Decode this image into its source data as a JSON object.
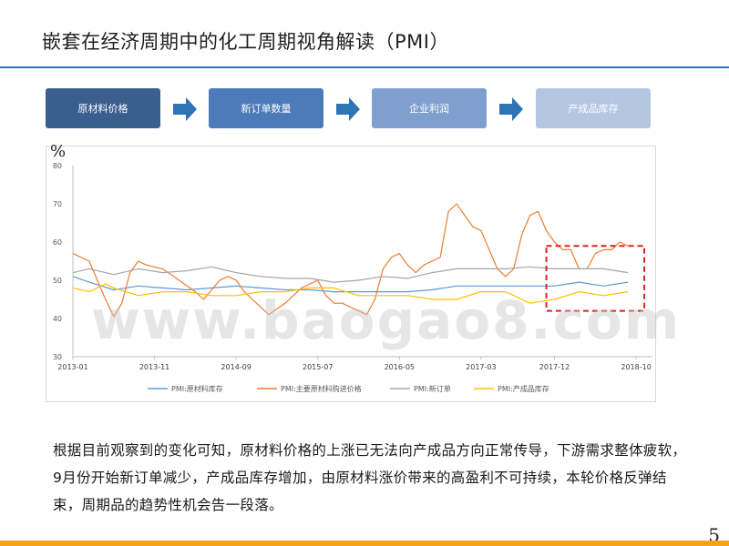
{
  "slide": {
    "title": "嵌套在经济周期中的化工周期视角解读（PMI）",
    "page_number": "5",
    "watermark": "www.baogao8.com",
    "body_text": "根据目前观察到的变化可知，原材料价格的上涨已无法向产成品方向正常传导，下游需求整体疲软，9月份开始新订单减少，产成品库存增加，由原材料涨价带来的高盈利不可持续，本轮价格反弹结束，周期品的趋势性机会告一段落。"
  },
  "flow": [
    {
      "label": "原材料价格",
      "color": "#3a5f8f"
    },
    {
      "label": "新订单数量",
      "color": "#4d7ab8"
    },
    {
      "label": "企业利润",
      "color": "#7fa0cf"
    },
    {
      "label": "产成品库存",
      "color": "#b4c7e2"
    }
  ],
  "flow_arrow_color": "#2e74b5",
  "highlight_color": "#e02020",
  "chart_data": {
    "type": "line",
    "unit_label": "%",
    "ylim": [
      30,
      80
    ],
    "yticks": [
      30,
      40,
      50,
      60,
      70,
      80
    ],
    "xlim": [
      "2013-01",
      "2018-12"
    ],
    "xticks": [
      "2013-01",
      "2013-11",
      "2014-09",
      "2015-07",
      "2016-05",
      "2017-03",
      "2017-12",
      "2018-10"
    ],
    "grid": false,
    "legend_position": "bottom",
    "highlight_box": {
      "x": [
        "2017-11",
        "2018-11"
      ],
      "y": [
        42,
        59
      ]
    },
    "series": [
      {
        "name": "PMI:原材料库存",
        "color": "#5b9bd5",
        "points": [
          [
            "2013-01",
            51
          ],
          [
            "2013-03",
            49.5
          ],
          [
            "2013-06",
            47.5
          ],
          [
            "2013-09",
            48.5
          ],
          [
            "2013-12",
            48
          ],
          [
            "2014-03",
            47.5
          ],
          [
            "2014-06",
            48
          ],
          [
            "2014-09",
            48.5
          ],
          [
            "2014-12",
            48
          ],
          [
            "2015-03",
            47.5
          ],
          [
            "2015-06",
            47.5
          ],
          [
            "2015-09",
            47
          ],
          [
            "2015-12",
            47
          ],
          [
            "2016-03",
            47
          ],
          [
            "2016-06",
            47
          ],
          [
            "2016-09",
            47.5
          ],
          [
            "2016-12",
            48.5
          ],
          [
            "2017-03",
            48.5
          ],
          [
            "2017-06",
            48.5
          ],
          [
            "2017-09",
            48.5
          ],
          [
            "2017-12",
            48.5
          ],
          [
            "2018-03",
            49.5
          ],
          [
            "2018-06",
            48.5
          ],
          [
            "2018-09",
            49.5
          ]
        ]
      },
      {
        "name": "PMI:主要原材料购进价格",
        "color": "#ed7d31",
        "points": [
          [
            "2013-01",
            57
          ],
          [
            "2013-03",
            55
          ],
          [
            "2013-05",
            45
          ],
          [
            "2013-06",
            40.5
          ],
          [
            "2013-07",
            44
          ],
          [
            "2013-08",
            52
          ],
          [
            "2013-09",
            55
          ],
          [
            "2013-10",
            54
          ],
          [
            "2013-12",
            53
          ],
          [
            "2014-02",
            50
          ],
          [
            "2014-04",
            47
          ],
          [
            "2014-05",
            45
          ],
          [
            "2014-07",
            50
          ],
          [
            "2014-08",
            51
          ],
          [
            "2014-09",
            50
          ],
          [
            "2014-10",
            47
          ],
          [
            "2014-12",
            43
          ],
          [
            "2015-01",
            41
          ],
          [
            "2015-03",
            44
          ],
          [
            "2015-05",
            48
          ],
          [
            "2015-07",
            50
          ],
          [
            "2015-08",
            46
          ],
          [
            "2015-09",
            44
          ],
          [
            "2015-10",
            44
          ],
          [
            "2015-12",
            42
          ],
          [
            "2016-01",
            41
          ],
          [
            "2016-02",
            45
          ],
          [
            "2016-03",
            53
          ],
          [
            "2016-04",
            56
          ],
          [
            "2016-05",
            57
          ],
          [
            "2016-06",
            54
          ],
          [
            "2016-07",
            52
          ],
          [
            "2016-08",
            54
          ],
          [
            "2016-09",
            55
          ],
          [
            "2016-10",
            56
          ],
          [
            "2016-11",
            68
          ],
          [
            "2016-12",
            70
          ],
          [
            "2017-01",
            67
          ],
          [
            "2017-02",
            64
          ],
          [
            "2017-03",
            63
          ],
          [
            "2017-04",
            58
          ],
          [
            "2017-05",
            53
          ],
          [
            "2017-06",
            51
          ],
          [
            "2017-07",
            53
          ],
          [
            "2017-08",
            62
          ],
          [
            "2017-09",
            67
          ],
          [
            "2017-10",
            68
          ],
          [
            "2017-11",
            63
          ],
          [
            "2017-12",
            60
          ],
          [
            "2018-01",
            58
          ],
          [
            "2018-02",
            58
          ],
          [
            "2018-03",
            53
          ],
          [
            "2018-04",
            53
          ],
          [
            "2018-05",
            57
          ],
          [
            "2018-06",
            58
          ],
          [
            "2018-07",
            58
          ],
          [
            "2018-08",
            60
          ],
          [
            "2018-09",
            59
          ]
        ]
      },
      {
        "name": "PMI:新订单",
        "color": "#a5a5a5",
        "points": [
          [
            "2013-01",
            52
          ],
          [
            "2013-03",
            53
          ],
          [
            "2013-06",
            51.5
          ],
          [
            "2013-09",
            53
          ],
          [
            "2013-12",
            52
          ],
          [
            "2014-03",
            52.5
          ],
          [
            "2014-06",
            53.5
          ],
          [
            "2014-09",
            52
          ],
          [
            "2014-12",
            51
          ],
          [
            "2015-03",
            50.5
          ],
          [
            "2015-06",
            50.5
          ],
          [
            "2015-09",
            49.5
          ],
          [
            "2015-12",
            50
          ],
          [
            "2016-03",
            51
          ],
          [
            "2016-06",
            50.5
          ],
          [
            "2016-09",
            52
          ],
          [
            "2016-12",
            53
          ],
          [
            "2017-03",
            53
          ],
          [
            "2017-06",
            53
          ],
          [
            "2017-09",
            53.5
          ],
          [
            "2017-12",
            53
          ],
          [
            "2018-03",
            53
          ],
          [
            "2018-06",
            53
          ],
          [
            "2018-09",
            52
          ]
        ]
      },
      {
        "name": "PMI:产成品库存",
        "color": "#ffc000",
        "points": [
          [
            "2013-01",
            48
          ],
          [
            "2013-03",
            47
          ],
          [
            "2013-05",
            49
          ],
          [
            "2013-06",
            48
          ],
          [
            "2013-09",
            46
          ],
          [
            "2013-12",
            47
          ],
          [
            "2014-03",
            47
          ],
          [
            "2014-06",
            46
          ],
          [
            "2014-09",
            46
          ],
          [
            "2014-12",
            47
          ],
          [
            "2015-03",
            47
          ],
          [
            "2015-06",
            48
          ],
          [
            "2015-09",
            48
          ],
          [
            "2015-12",
            46
          ],
          [
            "2016-03",
            46
          ],
          [
            "2016-06",
            46
          ],
          [
            "2016-09",
            45
          ],
          [
            "2016-12",
            45
          ],
          [
            "2017-03",
            47
          ],
          [
            "2017-06",
            47
          ],
          [
            "2017-09",
            44
          ],
          [
            "2017-12",
            45
          ],
          [
            "2018-03",
            47
          ],
          [
            "2018-06",
            46
          ],
          [
            "2018-09",
            47
          ]
        ]
      }
    ]
  }
}
